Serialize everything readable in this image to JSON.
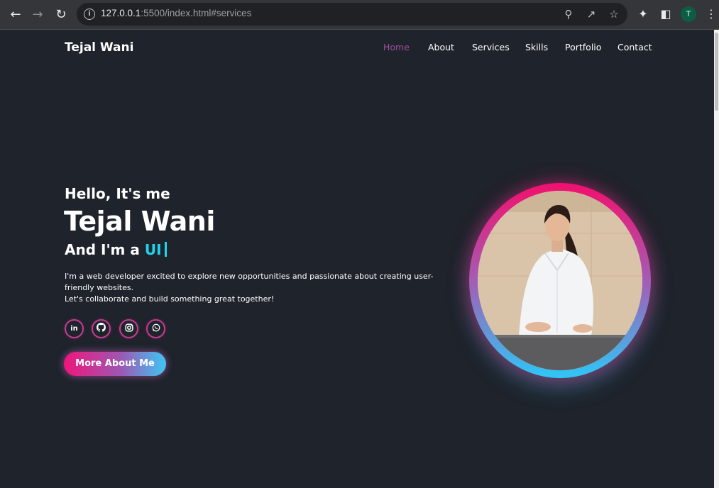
{
  "browser": {
    "url_host": "127.0.0.1",
    "url_rest": ":5500/index.html#services",
    "profile_initial": "T"
  },
  "header": {
    "logo": "Tejal Wani",
    "nav": [
      "Home",
      "About",
      "Services",
      "Skills",
      "Portfolio",
      "Contact"
    ],
    "active": "Home"
  },
  "hero": {
    "greeting": "Hello, It's me",
    "name": "Tejal Wani",
    "role_prefix": "And I'm a ",
    "role_typed": "UI",
    "description_line1": "I'm a web developer excited to explore new opportunities and passionate about creating user-friendly websites.",
    "description_line2": "Let's collaborate and build something great together!",
    "socials": [
      "linkedin-icon",
      "github-icon",
      "instagram-icon",
      "whatsapp-icon"
    ],
    "cta": "More About Me"
  },
  "colors": {
    "background": "#1f232b",
    "accent_pink": "#f0167a",
    "accent_cyan": "#1fd6ef",
    "nav_active": "#a04f9c"
  }
}
